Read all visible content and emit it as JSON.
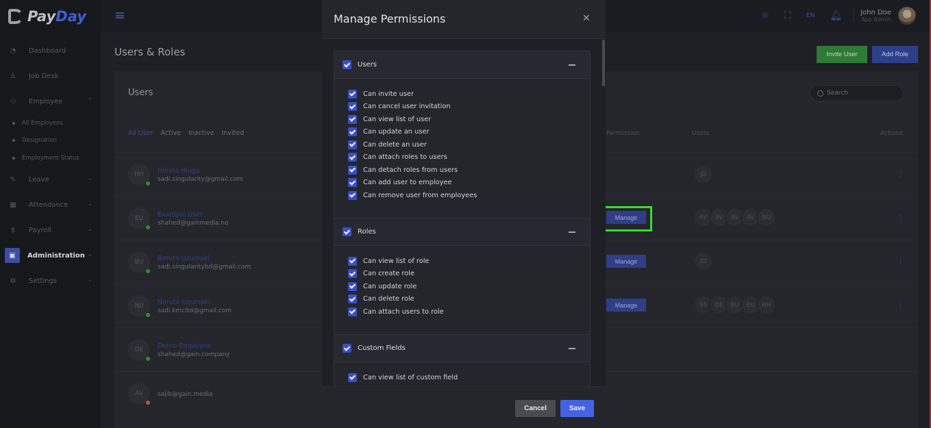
{
  "app": {
    "logo_pay": "Pay",
    "logo_day": "Day",
    "language": "EN",
    "user_name": "John Doe",
    "user_role": "App Admin"
  },
  "sidebar": {
    "items": [
      {
        "label": "Dashboard",
        "icon": "dashboard-icon"
      },
      {
        "label": "Job Desk",
        "icon": "user-icon"
      },
      {
        "label": "Employee",
        "icon": "users-icon"
      },
      {
        "label": "Leave",
        "icon": "edit-icon"
      },
      {
        "label": "Attendance",
        "icon": "calendar-icon"
      },
      {
        "label": "Payroll",
        "icon": "dollar-icon"
      },
      {
        "label": "Administration",
        "icon": "briefcase-icon"
      },
      {
        "label": "Settings",
        "icon": "gear-icon"
      }
    ],
    "sub_items": [
      "All Employees",
      "Designation",
      "Employment Status"
    ]
  },
  "page": {
    "title": "Users & Roles",
    "invite_label": "Invite User",
    "add_role_label": "Add Role",
    "card_title": "Users",
    "search_placeholder": "Search",
    "tabs": [
      "All User",
      "Active",
      "Inactive",
      "Invited"
    ],
    "columns": {
      "permission": "Permission",
      "users": "Users",
      "actions": "Actions"
    },
    "manage_label": "Manage",
    "rows": [
      {
        "initials": "HH",
        "name": "Hinata Hiuga",
        "email": "sadi.singularity@gmail.com"
      },
      {
        "initials": "EU",
        "name": "Example User",
        "email": "shahed@gainmedia.no"
      },
      {
        "initials": "BU",
        "name": "Boruto Uzumaki",
        "email": "sadi.singularitybd@gmail.com"
      },
      {
        "initials": "NU",
        "name": "Naruto Uzumaki",
        "email": "sadi.kmcltd@gmail.com"
      },
      {
        "initials": "DE",
        "name": "Demo Employee",
        "email": "shahed@gain.company"
      },
      {
        "initials": "AV",
        "name": "",
        "email": "sajib@gain.media"
      }
    ],
    "role_users": [
      [
        "JD"
      ],
      [
        "AV",
        "AV",
        "AV",
        "AV",
        "NU"
      ],
      [
        "JD"
      ],
      [
        "SS",
        "DE",
        "BU",
        "EU",
        "HH"
      ]
    ]
  },
  "modal": {
    "title": "Manage Permissions",
    "cancel_label": "Cancel",
    "save_label": "Save",
    "sections": [
      {
        "label": "Users",
        "permissions": [
          "Can invite user",
          "Can cancel user invitation",
          "Can view list of user",
          "Can update an user",
          "Can delete an user",
          "Can attach roles to users",
          "Can detach roles from users",
          "Can add user to employee",
          "Can remove user from employees"
        ]
      },
      {
        "label": "Roles",
        "permissions": [
          "Can view list of role",
          "Can create role",
          "Can update role",
          "Can delete role",
          "Can attach users to role"
        ]
      },
      {
        "label": "Custom Fields",
        "permissions": [
          "Can view list of custom field"
        ]
      }
    ]
  }
}
